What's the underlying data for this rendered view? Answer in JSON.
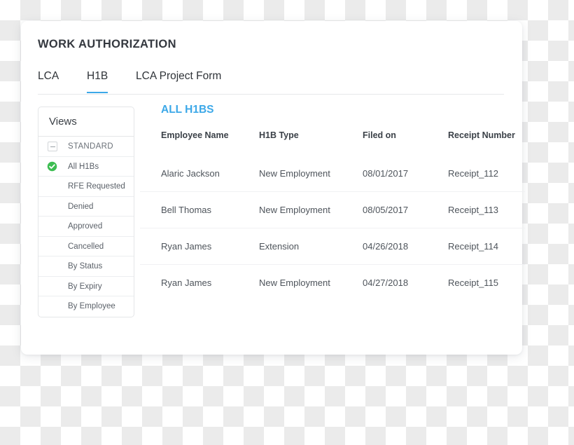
{
  "card": {
    "title": "WORK AUTHORIZATION"
  },
  "tabs": [
    {
      "label": "LCA",
      "active": false
    },
    {
      "label": "H1B",
      "active": true
    },
    {
      "label": "LCA Project Form",
      "active": false
    }
  ],
  "sidebar": {
    "header": "Views",
    "items": [
      {
        "label": "STANDARD",
        "icon": "minus-collapse-icon",
        "type": "group"
      },
      {
        "label": "All H1Bs",
        "icon": "green-check-circle-icon",
        "type": "item",
        "selected": true
      },
      {
        "label": "RFE Requested",
        "icon": "",
        "type": "item"
      },
      {
        "label": "Denied",
        "icon": "",
        "type": "item"
      },
      {
        "label": "Approved",
        "icon": "",
        "type": "item"
      },
      {
        "label": "Cancelled",
        "icon": "",
        "type": "item"
      },
      {
        "label": "By Status",
        "icon": "",
        "type": "item"
      },
      {
        "label": "By Expiry",
        "icon": "",
        "type": "item"
      },
      {
        "label": "By Employee",
        "icon": "",
        "type": "item"
      }
    ]
  },
  "main": {
    "section_title": "ALL H1BS",
    "columns": [
      "Employee Name",
      "H1B Type",
      "Filed on",
      "Receipt Number"
    ],
    "rows": [
      {
        "employee_name": "Alaric Jackson",
        "h1b_type": "New Employment",
        "filed_on": "08/01/2017",
        "receipt_number": "Receipt_112"
      },
      {
        "employee_name": "Bell Thomas",
        "h1b_type": "New Employment",
        "filed_on": "08/05/2017",
        "receipt_number": "Receipt_113"
      },
      {
        "employee_name": "Ryan James",
        "h1b_type": "Extension",
        "filed_on": "04/26/2018",
        "receipt_number": "Receipt_114"
      },
      {
        "employee_name": "Ryan James",
        "h1b_type": "New Employment",
        "filed_on": "04/27/2018",
        "receipt_number": "Receipt_115"
      }
    ]
  },
  "colors": {
    "accent_blue": "#3CA8E8",
    "success_green": "#3DBD52",
    "title_text": "#34383F",
    "body_text": "#4E545B",
    "border": "#E4E6E8"
  }
}
